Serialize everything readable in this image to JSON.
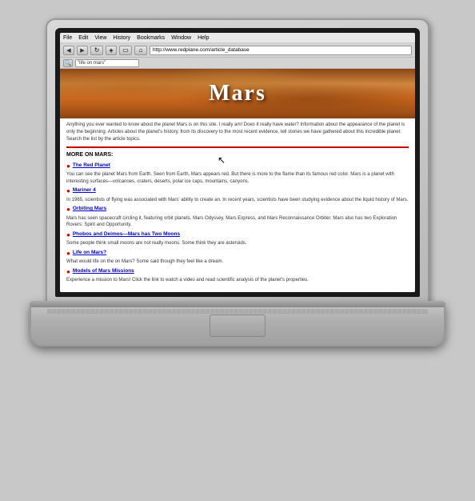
{
  "browser": {
    "menu": {
      "items": [
        "File",
        "Edit",
        "View",
        "History",
        "Bookmarks",
        "Window",
        "Help"
      ]
    },
    "toolbar": {
      "back_label": "◀",
      "forward_label": "▶",
      "reload_label": "↻",
      "add_label": "+",
      "window_label": "▭",
      "home_label": "⌂",
      "url": "http://www.redplane.com/article_database"
    },
    "search": {
      "placeholder": "\"life on mars\""
    }
  },
  "page": {
    "banner_title": "Mars",
    "intro": "Anything you ever wanted to know about the planet Mars is on this site. I really am! Does it really have water? Information about the appearance of the planet is only the beginning. Articles about the planet's history, from its discovery to the most recent evidence, tell stories we have gathered about this incredible planet. Search the list by the article topics.",
    "section_title": "MORE ON MARS:",
    "items": [
      {
        "title": "The Red Planet",
        "desc": "You can see the planet Mars from Earth. Seen from Earth, Mars appears red. But there is more to the flame than its famous red color. Mars is a planet with interesting surfaces—volcanoes, craters, deserts, polar ice caps, mountains, canyons."
      },
      {
        "title": "Mariner 4",
        "desc": "In 1965, scientists of flying was associated with Mars' ability to create an. In recent years, scientists have been studying evidence about the liquid history of Mars."
      },
      {
        "title": "Orbiting Mars",
        "desc": "Mars has seen spacecraft circling it, featuring orbit planets. Mars Odyssey, Mars Express, and Mars Reconnaissance Orbiter. Mars also has two Exploration Rovers: Spirit and Opportunity."
      },
      {
        "title": "Phobos and Deimos—Mars has Two Moons",
        "desc": "Some people think small moons are not really moons. Some think they are asteroids."
      },
      {
        "title": "Life on Mars?",
        "desc": "What would life on the on Mars? Some said though they feel like a dream."
      },
      {
        "title": "Models of Mars Missions",
        "desc": "Experience a mission to Mars! Click the link to watch a video and read scientific analysis of the planet's properties."
      }
    ]
  }
}
